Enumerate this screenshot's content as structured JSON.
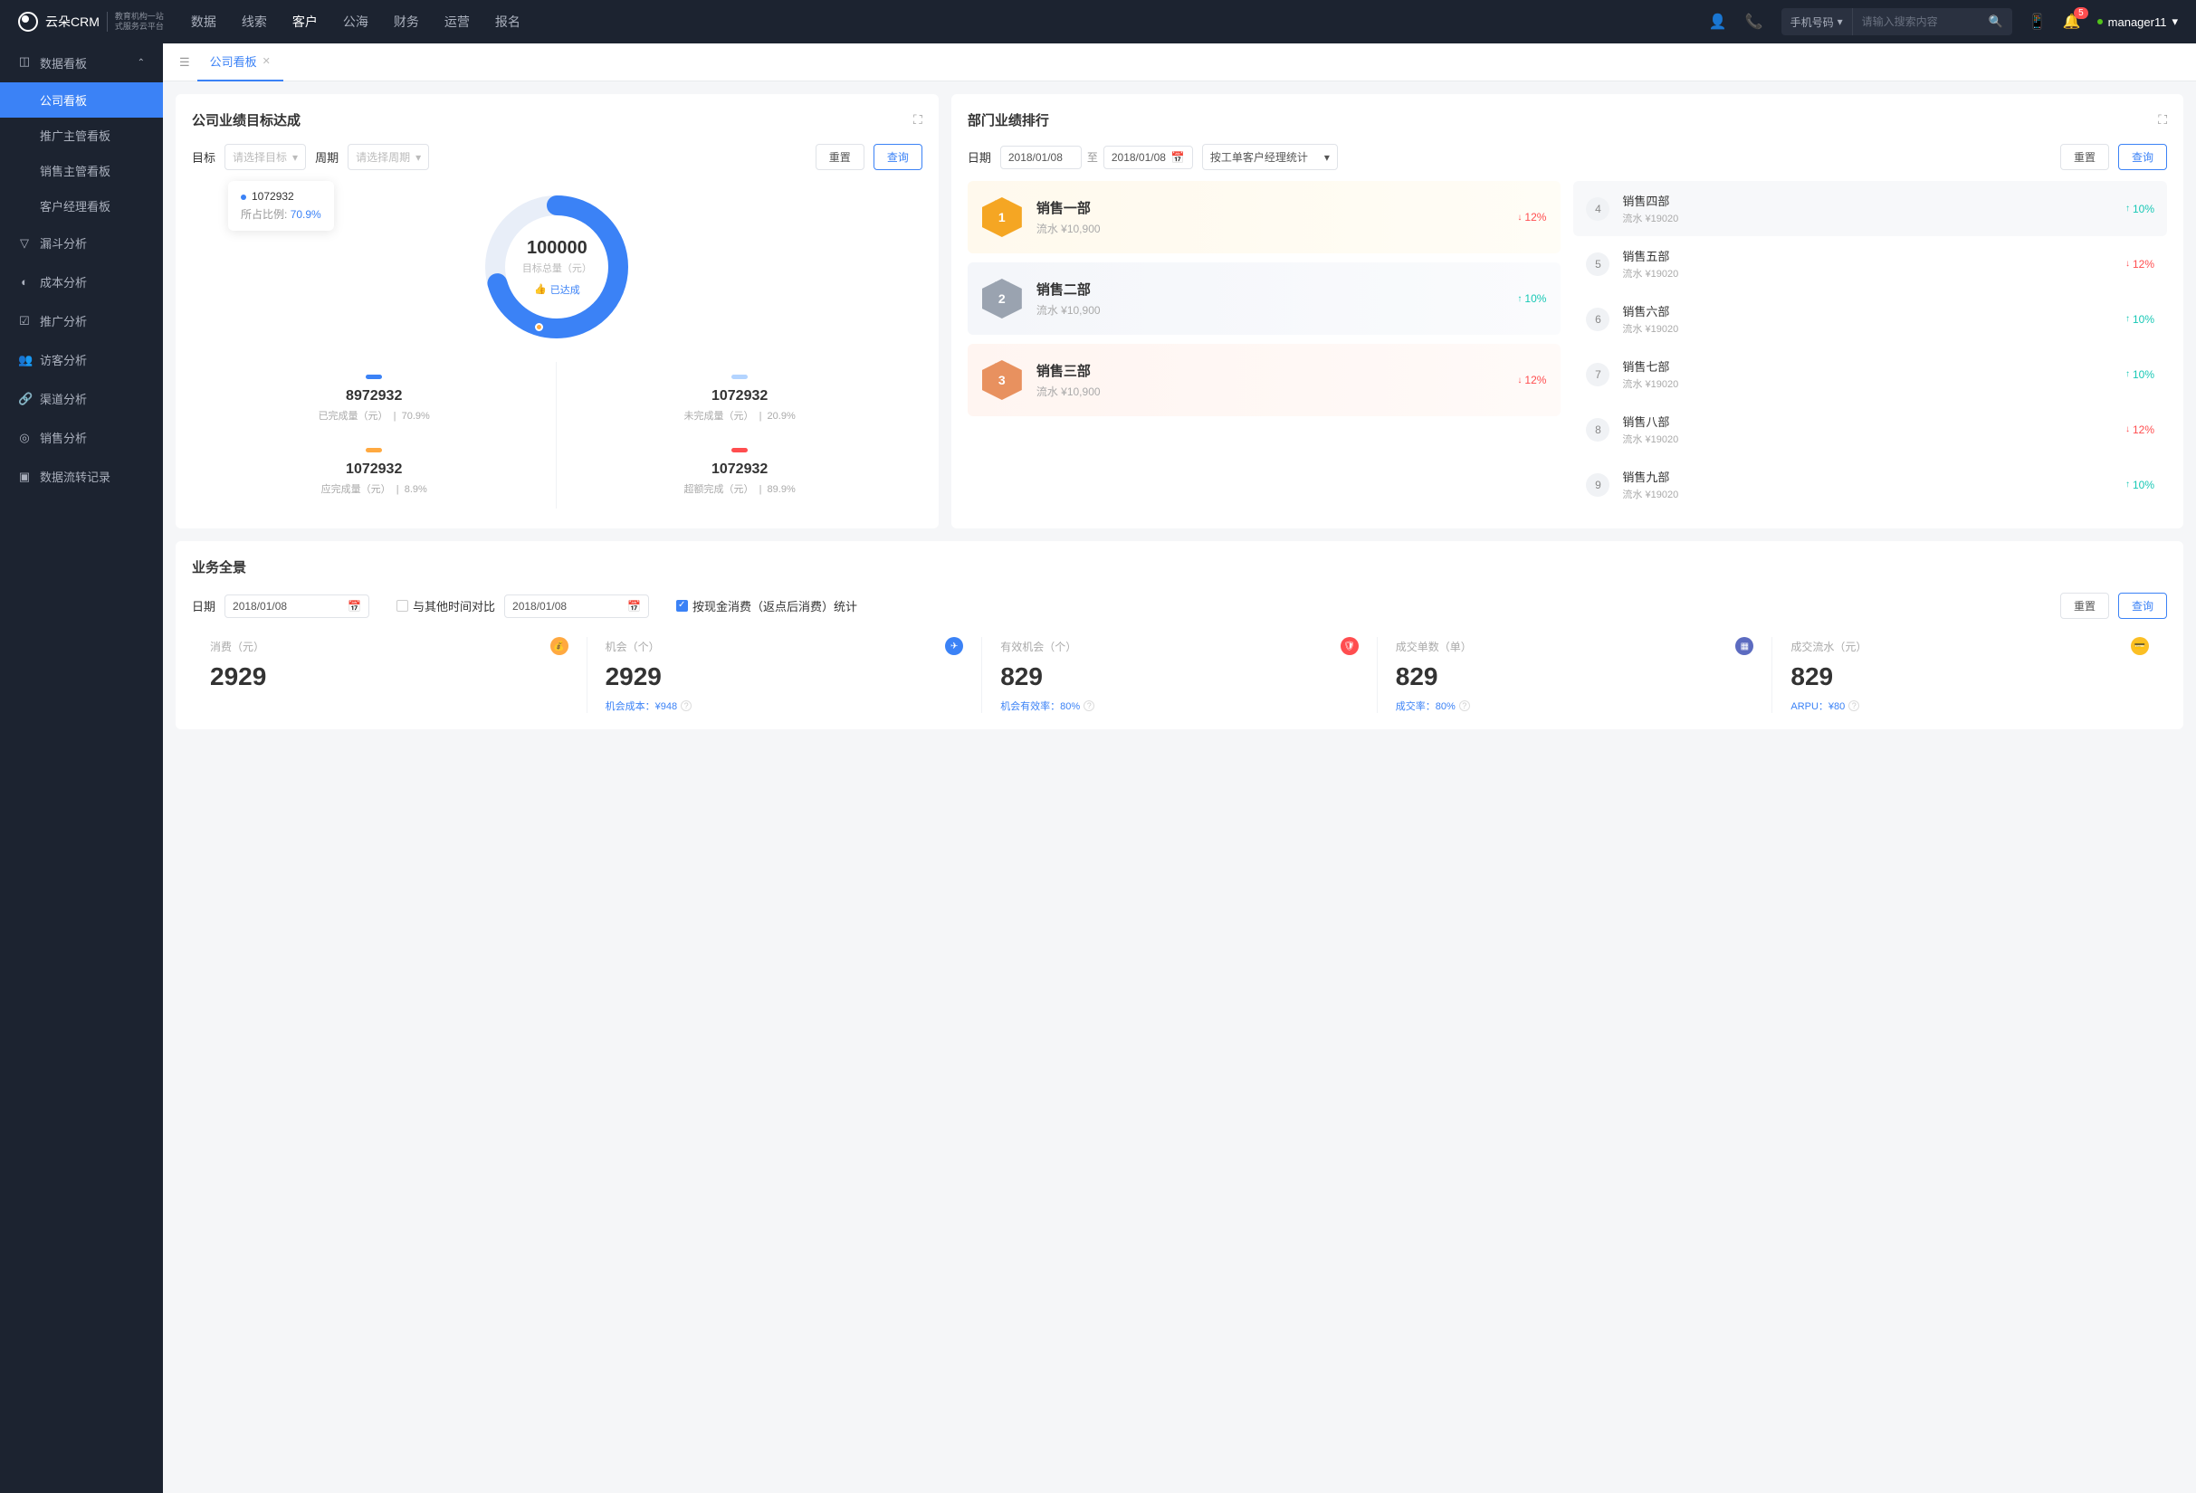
{
  "header": {
    "logo_main": "云朵CRM",
    "logo_sub1": "教育机构一站",
    "logo_sub2": "式服务云平台",
    "nav": [
      "数据",
      "线索",
      "客户",
      "公海",
      "财务",
      "运营",
      "报名"
    ],
    "nav_active": 2,
    "search_type": "手机号码",
    "search_placeholder": "请输入搜索内容",
    "notif_count": "5",
    "user": "manager11"
  },
  "sidebar": {
    "main": {
      "label": "数据看板",
      "expanded": true
    },
    "subs": [
      "公司看板",
      "推广主管看板",
      "销售主管看板",
      "客户经理看板"
    ],
    "active_sub": 0,
    "others": [
      "漏斗分析",
      "成本分析",
      "推广分析",
      "访客分析",
      "渠道分析",
      "销售分析",
      "数据流转记录"
    ]
  },
  "tab": {
    "label": "公司看板"
  },
  "target_card": {
    "title": "公司业绩目标达成",
    "filters": {
      "target_label": "目标",
      "target_ph": "请选择目标",
      "period_label": "周期",
      "period_ph": "请选择周期"
    },
    "reset": "重置",
    "query": "查询",
    "tooltip": {
      "value": "1072932",
      "ratio_label": "所占比例:",
      "ratio": "70.9%"
    },
    "donut": {
      "value": "100000",
      "label": "目标总量（元）",
      "badge": "已达成"
    },
    "chart_data": {
      "type": "pie",
      "completed_pct": 70.9,
      "remaining_pct": 29.1
    },
    "stats": [
      {
        "bar": "blue",
        "num": "8972932",
        "desc": "已完成量（元）",
        "pct": "70.9%"
      },
      {
        "bar": "lblue",
        "num": "1072932",
        "desc": "未完成量（元）",
        "pct": "20.9%"
      },
      {
        "bar": "orange",
        "num": "1072932",
        "desc": "应完成量（元）",
        "pct": "8.9%"
      },
      {
        "bar": "red",
        "num": "1072932",
        "desc": "超额完成（元）",
        "pct": "89.9%"
      }
    ]
  },
  "rank_card": {
    "title": "部门业绩排行",
    "filters": {
      "date_label": "日期",
      "date_from": "2018/01/08",
      "date_sep": "至",
      "date_to": "2018/01/08",
      "stat_type": "按工单客户经理统计"
    },
    "reset": "重置",
    "query": "查询",
    "podium": [
      {
        "rank": "1",
        "cls": "gold",
        "name": "销售一部",
        "flow": "流水 ¥10,900",
        "trend": "12%",
        "dir": "down"
      },
      {
        "rank": "2",
        "cls": "silver",
        "name": "销售二部",
        "flow": "流水 ¥10,900",
        "trend": "10%",
        "dir": "up"
      },
      {
        "rank": "3",
        "cls": "bronze",
        "name": "销售三部",
        "flow": "流水 ¥10,900",
        "trend": "12%",
        "dir": "down"
      }
    ],
    "list": [
      {
        "rank": "4",
        "name": "销售四部",
        "flow": "流水 ¥19020",
        "trend": "10%",
        "dir": "up"
      },
      {
        "rank": "5",
        "name": "销售五部",
        "flow": "流水 ¥19020",
        "trend": "12%",
        "dir": "down"
      },
      {
        "rank": "6",
        "name": "销售六部",
        "flow": "流水 ¥19020",
        "trend": "10%",
        "dir": "up"
      },
      {
        "rank": "7",
        "name": "销售七部",
        "flow": "流水 ¥19020",
        "trend": "10%",
        "dir": "up"
      },
      {
        "rank": "8",
        "name": "销售八部",
        "flow": "流水 ¥19020",
        "trend": "12%",
        "dir": "down"
      },
      {
        "rank": "9",
        "name": "销售九部",
        "flow": "流水 ¥19020",
        "trend": "10%",
        "dir": "up"
      }
    ]
  },
  "overview": {
    "title": "业务全景",
    "date_label": "日期",
    "date1": "2018/01/08",
    "compare_label": "与其他时间对比",
    "date2": "2018/01/08",
    "check_label": "按现金消费（返点后消费）统计",
    "reset": "重置",
    "query": "查询",
    "items": [
      {
        "label": "消费（元）",
        "val": "2929",
        "icon": "orange",
        "foot": null
      },
      {
        "label": "机会（个）",
        "val": "2929",
        "icon": "blue",
        "foot": "机会成本：¥948"
      },
      {
        "label": "有效机会（个）",
        "val": "829",
        "icon": "red",
        "foot": "机会有效率：80%"
      },
      {
        "label": "成交单数（单）",
        "val": "829",
        "icon": "purple",
        "foot": "成交率：80%"
      },
      {
        "label": "成交流水（元）",
        "val": "829",
        "icon": "yellow",
        "foot": "ARPU：¥80"
      }
    ]
  }
}
